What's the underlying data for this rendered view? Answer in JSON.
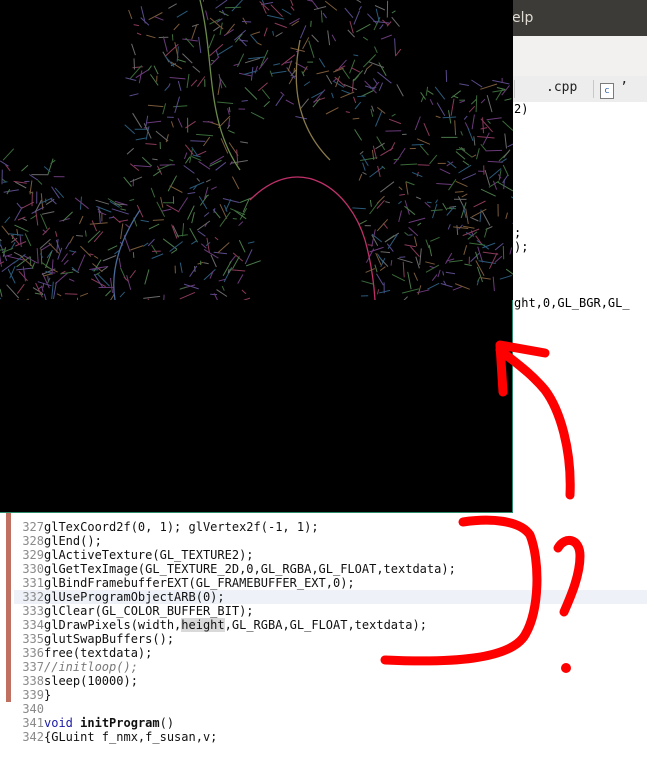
{
  "menubar": {
    "help_label": "Help",
    "help_visible": "elp"
  },
  "tabs": [
    {
      "label": ".cpp"
    },
    {
      "label": "’",
      "icon": "c-file-icon"
    }
  ],
  "partial_code": {
    "line_a": "2)",
    "line_b": ";",
    "line_c": ");",
    "line_d": "ght,0,GL_BGR,GL_"
  },
  "code_lines": [
    {
      "num": "327",
      "parts": [
        {
          "t": "glTexCoord2f",
          "c": "fn"
        },
        {
          "t": "(0, 1); ",
          "c": ""
        },
        {
          "t": "glVertex2f",
          "c": "fn"
        },
        {
          "t": "(-1, 1);",
          "c": ""
        }
      ]
    },
    {
      "num": "328",
      "parts": [
        {
          "t": "glEnd",
          "c": "fn"
        },
        {
          "t": "();",
          "c": ""
        }
      ]
    },
    {
      "num": "329",
      "parts": [
        {
          "t": "glActiveTexture",
          "c": "fn"
        },
        {
          "t": "(GL_TEXTURE2);",
          "c": ""
        }
      ]
    },
    {
      "num": "330",
      "parts": [
        {
          "t": "glGetTexImage",
          "c": "fn"
        },
        {
          "t": "(GL_TEXTURE_2D,0,GL_RGBA,GL_FLOAT,textdata);",
          "c": ""
        }
      ]
    },
    {
      "num": "331",
      "parts": [
        {
          "t": "glBindFramebufferEXT(GL_FRAMEBUFFER_EXT,0);",
          "c": ""
        }
      ]
    },
    {
      "num": "332",
      "parts": [
        {
          "t": "glUseProgramObjectARB(0);",
          "c": ""
        }
      ]
    },
    {
      "num": "333",
      "parts": [
        {
          "t": "glClear",
          "c": "fn"
        },
        {
          "t": "(GL_COLOR_BUFFER_BIT);",
          "c": ""
        }
      ]
    },
    {
      "num": "334",
      "parts": [
        {
          "t": "glDrawPixels",
          "c": "fn"
        },
        {
          "t": "(width,",
          "c": ""
        },
        {
          "t": "height",
          "c": "hl"
        },
        {
          "t": ",GL_RGBA,GL_FLOAT,textdata);",
          "c": ""
        }
      ]
    },
    {
      "num": "335",
      "parts": [
        {
          "t": "glutSwapBuffers",
          "c": "fn"
        },
        {
          "t": "();",
          "c": ""
        }
      ]
    },
    {
      "num": "336",
      "parts": [
        {
          "t": "free",
          "c": "fn"
        },
        {
          "t": "(textdata);",
          "c": ""
        }
      ]
    },
    {
      "num": "337",
      "parts": [
        {
          "t": "//initloop();",
          "c": "cm"
        }
      ]
    },
    {
      "num": "338",
      "parts": [
        {
          "t": "sleep",
          "c": "fn"
        },
        {
          "t": "(10000);",
          "c": ""
        }
      ]
    },
    {
      "num": "339",
      "parts": [
        {
          "t": "}",
          "c": ""
        }
      ]
    },
    {
      "num": "340",
      "parts": []
    },
    {
      "num": "341",
      "parts": [
        {
          "t": "void",
          "c": "kw"
        },
        {
          "t": " ",
          "c": ""
        },
        {
          "t": "initProgram",
          "c": "bold"
        },
        {
          "t": "()",
          "c": ""
        }
      ]
    },
    {
      "num": "342",
      "parts": [
        {
          "t": "{GLuint f_nmx,f_susan,v;",
          "c": ""
        }
      ]
    }
  ],
  "glwindow": {
    "title": ""
  },
  "colors": {
    "annotation": "#ff0000",
    "gl_border": "#2a8a6a",
    "menubar": "#3c3b37"
  }
}
